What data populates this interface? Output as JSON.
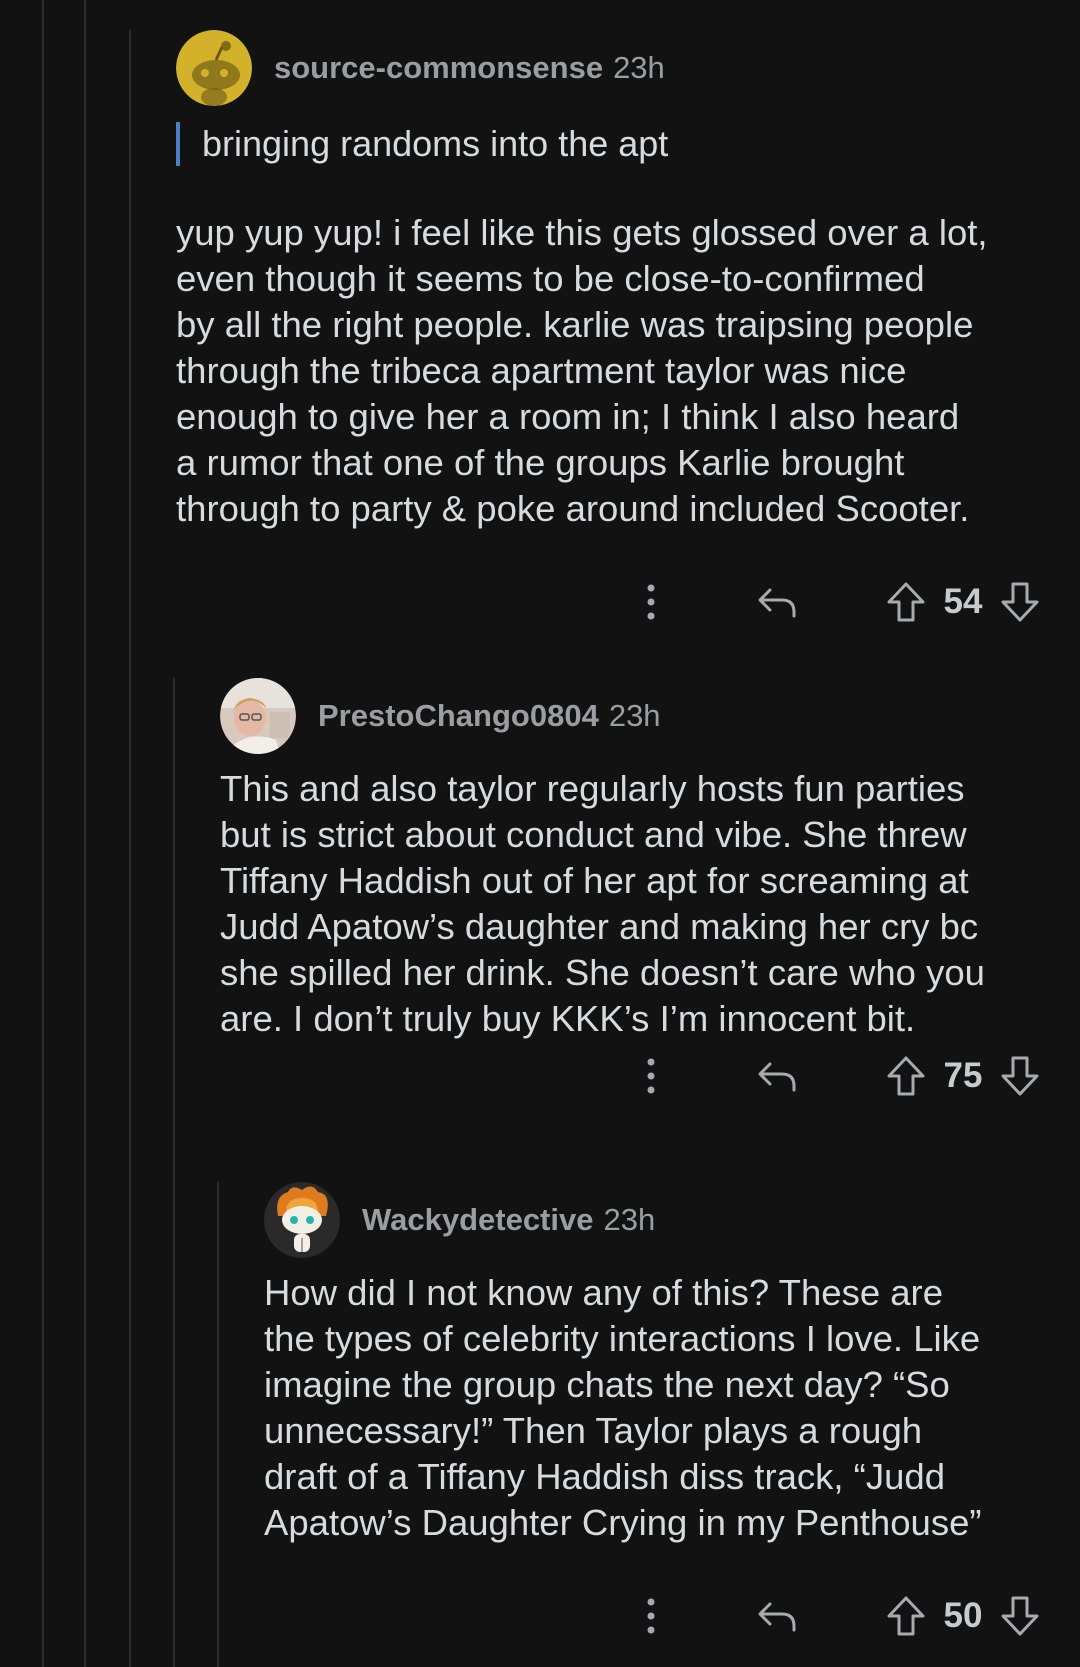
{
  "comments": [
    {
      "author": "source-commonsense",
      "time": "23h",
      "avatar": "reddit-snoo-avatar-yellow",
      "quote": "bringing randoms into the apt",
      "body": "yup yup yup! i feel like this gets glossed over a lot,\neven though it seems to be close-to-confirmed\nby all the right people. karlie was traipsing people\nthrough the tribeca apartment taylor was nice\nenough to give her a room in; I think I also heard\na rumor that one of the groups Karlie brought\nthrough to party & poke around included Scooter.",
      "score": "54"
    },
    {
      "author": "PrestoChango0804",
      "time": "23h",
      "avatar": "profile-photo-avatar",
      "body": "This and also taylor regularly hosts fun parties\nbut is strict about conduct and vibe. She threw\nTiffany Haddish out of her apt for screaming at\nJudd Apatow’s daughter and making her cry bc\nshe spilled her drink. She doesn’t care who you\nare. I don’t truly buy KKK’s I’m innocent bit.",
      "score": "75"
    },
    {
      "author": "Wackydetective",
      "time": "23h",
      "avatar": "reddit-snoo-avatar-fire-hair",
      "body": "How did I not know any of this? These are\nthe types of celebrity interactions I love. Like\nimagine the group chats the next day? “So\nunnecessary!” Then Taylor plays a rough\ndraft of a Tiffany Haddish diss track, “Judd\nApatow’s Daughter Crying in my Penthouse”",
      "score": "50"
    }
  ],
  "icons": {
    "more": "more-options-icon",
    "reply": "reply-icon",
    "upvote": "upvote-arrow-icon",
    "downvote": "downvote-arrow-icon"
  },
  "colors": {
    "background": "#121212",
    "text": "#d8dadc",
    "meta": "#9a9ea2",
    "quote_bar": "#4a7fc1",
    "thread_line": "#2c2c2c"
  }
}
